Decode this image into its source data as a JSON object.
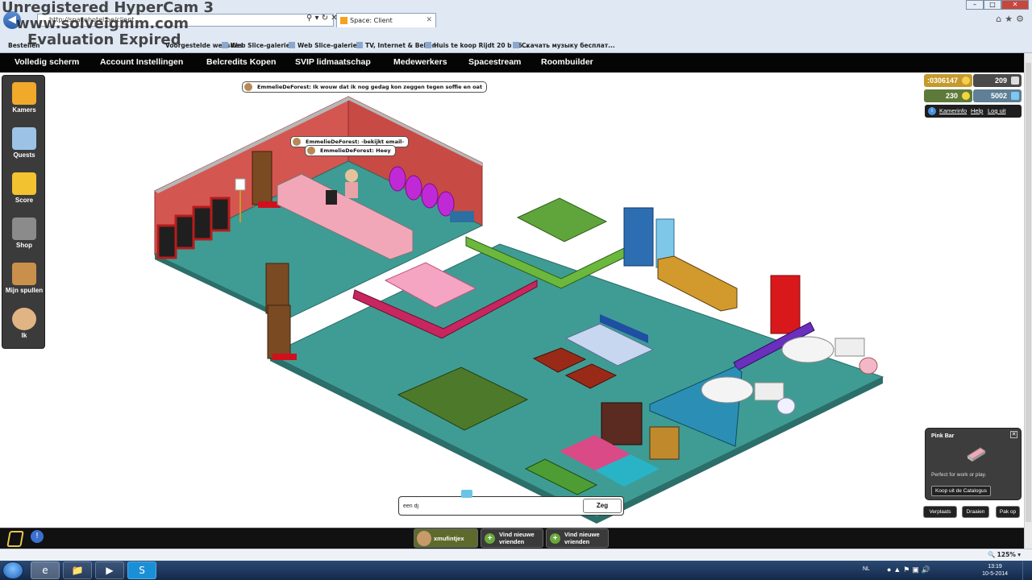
{
  "watermark": {
    "line1": "Unregistered HyperCam 3",
    "line2": "www.solveigmm.com",
    "line3": "Evaluation Expired"
  },
  "browser": {
    "url": "http://spacehotel.be/client",
    "tab_title": "Space: Client",
    "favorites": [
      "Bestellen",
      "Voorgestelde websites",
      "Web Slice-galerie",
      "Web Slice-galerie",
      "TV, Internet & Bellen",
      "Huis te koop Rijdt 20 b 66...",
      "Скачать музыку бесплат..."
    ]
  },
  "nav": {
    "items": [
      "Volledig scherm",
      "Account Instellingen",
      "Belcredits Kopen",
      "SVIP lidmaatschap",
      "Medewerkers",
      "Spacestream",
      "Roombuilder"
    ]
  },
  "toolbar": {
    "items": [
      {
        "label": "Kamers",
        "icon": "rooms-icon",
        "color": "#f0a92b"
      },
      {
        "label": "Quests",
        "icon": "quests-icon",
        "color": "#9cc3e6"
      },
      {
        "label": "Score",
        "icon": "score-icon",
        "color": "#f2c230"
      },
      {
        "label": "Shop",
        "icon": "shop-icon",
        "color": "#8b8b8b"
      },
      {
        "label": "Mijn spullen",
        "icon": "inventory-icon",
        "color": "#c9904c"
      },
      {
        "label": "Ik",
        "icon": "avatar-icon",
        "color": "#e1b583"
      }
    ]
  },
  "currency": {
    "credits": ":0306147",
    "duckets": "209",
    "stars": "230",
    "diamonds": "5002"
  },
  "room_links": {
    "info": "Kamerinfo",
    "help": "Help",
    "logout": "Log uit"
  },
  "chat_bubbles": [
    {
      "user": "EmmelieDeForest",
      "text": "EmmelieDeForest: Ik wouw dat ik nog gedag kon zeggen tegen soffie en oat"
    },
    {
      "user": "EmmelieDeForest",
      "text": "EmmelieDeForest: -bekijkt email-"
    },
    {
      "user": "EmmelieDeForest",
      "text": "EmmelieDeForest: Heey"
    }
  ],
  "furni_info": {
    "title": "Pink Bar",
    "description": "Perfect for work or play.",
    "buy_label": "Koop uit de Catalogus"
  },
  "furni_actions": {
    "move": "Verplaats",
    "rotate": "Draaien",
    "pickup": "Pak op"
  },
  "chat": {
    "value": "een dj",
    "send": "Zeg"
  },
  "bottom": {
    "username": "xmufintjex",
    "find_friends_1": "Vind nieuwe vrienden",
    "find_friends_2": "Vind nieuwe vrienden"
  },
  "status": {
    "zoom": "125%"
  },
  "taskbar": {
    "lang": "NL",
    "time": "13:19",
    "date": "10-5-2014"
  },
  "colors": {
    "floor": "#3f9c94",
    "wall_red": "#d7544d",
    "nav_bg": "#050505",
    "credits": "#c59a2d"
  }
}
